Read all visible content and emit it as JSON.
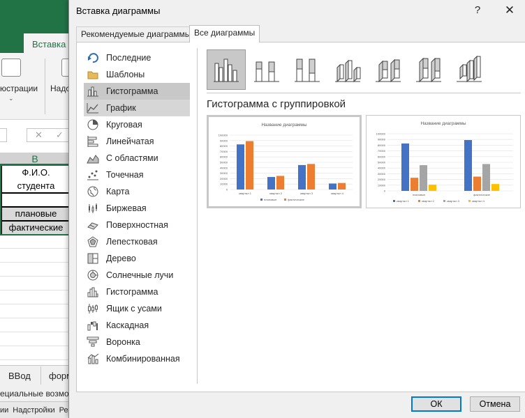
{
  "excel": {
    "tabs": {
      "left_partial": "Ф",
      "insert": "Вставка"
    },
    "ribbon": {
      "illustrations_partial": "юстрации",
      "addins_partial": "Надс"
    },
    "formula_bar": {
      "cancel": "✕",
      "enter": "✓"
    },
    "column_header": "B",
    "cells": {
      "fio": "Ф.И.О. студента",
      "planned": "плановые",
      "actual": "фактические"
    },
    "sheet_tabs": [
      "ВВод",
      "форм"
    ],
    "status": "ециальные возмож",
    "taskbar": [
      "ии",
      "Надстройки",
      "Ре"
    ],
    "accent": "#217346"
  },
  "dialog": {
    "title": "Вставка диаграммы",
    "help": "?",
    "close": "✕",
    "tabs": {
      "recommended": "Рекомендуемые диаграммы",
      "all": "Все диаграммы"
    },
    "categories": [
      {
        "label": "Последние",
        "icon": "recent-icon"
      },
      {
        "label": "Шаблоны",
        "icon": "folder-icon"
      },
      {
        "label": "Гистограмма",
        "icon": "column-chart-icon"
      },
      {
        "label": "График",
        "icon": "line-chart-icon"
      },
      {
        "label": "Круговая",
        "icon": "pie-chart-icon"
      },
      {
        "label": "Линейчатая",
        "icon": "bar-chart-icon"
      },
      {
        "label": "С областями",
        "icon": "area-chart-icon"
      },
      {
        "label": "Точечная",
        "icon": "scatter-chart-icon"
      },
      {
        "label": "Карта",
        "icon": "map-chart-icon"
      },
      {
        "label": "Биржевая",
        "icon": "stock-chart-icon"
      },
      {
        "label": "Поверхностная",
        "icon": "surface-chart-icon"
      },
      {
        "label": "Лепестковая",
        "icon": "radar-chart-icon"
      },
      {
        "label": "Дерево",
        "icon": "treemap-chart-icon"
      },
      {
        "label": "Солнечные лучи",
        "icon": "sunburst-chart-icon"
      },
      {
        "label": "Гистограмма",
        "icon": "histogram-chart-icon"
      },
      {
        "label": "Ящик с усами",
        "icon": "box-whisker-chart-icon"
      },
      {
        "label": "Каскадная",
        "icon": "waterfall-chart-icon"
      },
      {
        "label": "Воронка",
        "icon": "funnel-chart-icon"
      },
      {
        "label": "Комбинированная",
        "icon": "combo-chart-icon"
      }
    ],
    "selected_category": 2,
    "hovered_category": 3,
    "subtypes_selected": 0,
    "subtitle": "Гистограмма с группировкой",
    "buttons": {
      "ok": "ОК",
      "cancel": "Отмена"
    },
    "accent": "#0078d7"
  },
  "chart_data": [
    {
      "type": "bar",
      "title": "Название диаграммы",
      "categories": [
        "квартал 1",
        "квартал 2",
        "квартал 3",
        "квартал 4"
      ],
      "series": [
        {
          "name": "плановые",
          "values": [
            83000,
            23000,
            45000,
            11000
          ],
          "color": "#4472c4"
        },
        {
          "name": "фактические",
          "values": [
            89000,
            25000,
            47000,
            12000
          ],
          "color": "#ed7d31"
        }
      ],
      "yticks": [
        "100000",
        "90000",
        "80000",
        "70000",
        "60000",
        "50000",
        "40000",
        "30000",
        "20000",
        "10000",
        "0"
      ],
      "ylim": [
        0,
        100000
      ],
      "legend": "bottom",
      "grid": true
    },
    {
      "type": "bar",
      "title": "Название диаграммы",
      "categories": [
        "плановые",
        "фактические"
      ],
      "series": [
        {
          "name": "квартал 1",
          "values": [
            83000,
            89000
          ],
          "color": "#4472c4"
        },
        {
          "name": "квартал 2",
          "values": [
            23000,
            25000
          ],
          "color": "#ed7d31"
        },
        {
          "name": "квартал 3",
          "values": [
            45000,
            47000
          ],
          "color": "#a5a5a5"
        },
        {
          "name": "квартал 4",
          "values": [
            11000,
            12000
          ],
          "color": "#ffc000"
        }
      ],
      "yticks": [
        "100000",
        "90000",
        "80000",
        "70000",
        "60000",
        "50000",
        "40000",
        "30000",
        "20000",
        "10000",
        "0"
      ],
      "ylim": [
        0,
        100000
      ],
      "legend": "bottom",
      "grid": true
    }
  ]
}
